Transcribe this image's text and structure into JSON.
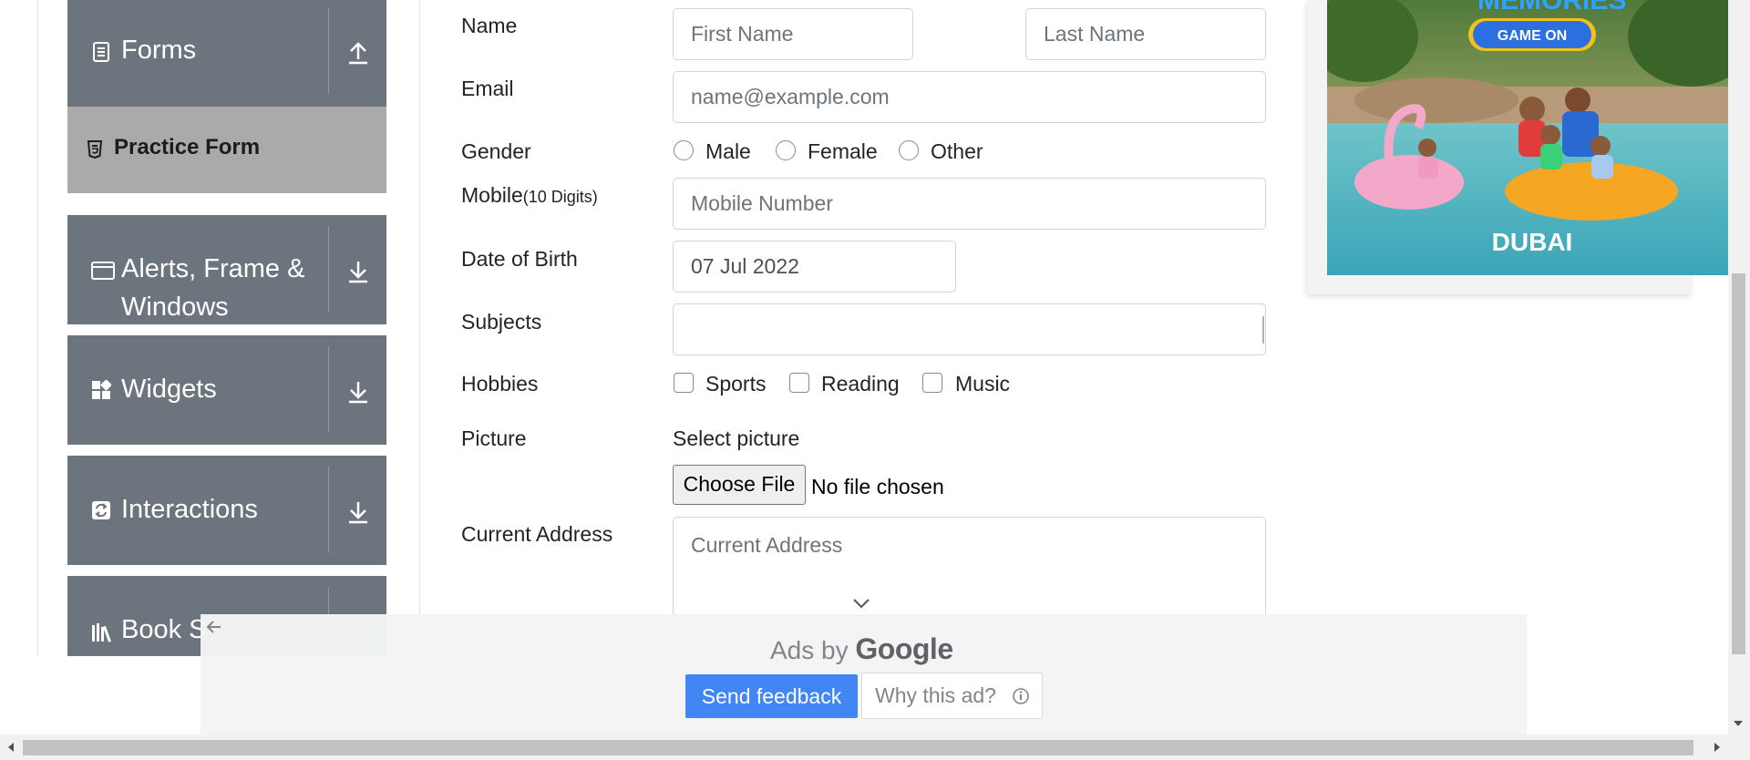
{
  "sidebar": {
    "forms": {
      "label": "Forms",
      "icon": "document-icon",
      "arrow": "arrow-up-icon"
    },
    "practice_form": {
      "label": "Practice Form",
      "icon": "html-file-icon"
    },
    "alerts": {
      "label_line1": "Alerts, Frame &",
      "label_line2": "Windows",
      "icon": "browser-window-icon",
      "arrow": "arrow-down-icon"
    },
    "widgets": {
      "label": "Widgets",
      "icon": "widgets-icon",
      "arrow": "arrow-down-icon"
    },
    "interactions": {
      "label": "Interactions",
      "icon": "interactions-icon",
      "arrow": "arrow-down-icon"
    },
    "book_store": {
      "label": "Book S",
      "icon": "books-icon"
    }
  },
  "form": {
    "name_label": "Name",
    "first_name_placeholder": "First Name",
    "last_name_placeholder": "Last Name",
    "email_label": "Email",
    "email_placeholder": "name@example.com",
    "gender_label": "Gender",
    "gender_options": [
      "Male",
      "Female",
      "Other"
    ],
    "mobile_label": "Mobile",
    "mobile_hint": "(10 Digits)",
    "mobile_placeholder": "Mobile Number",
    "dob_label": "Date of Birth",
    "dob_value": "07 Jul 2022",
    "subjects_label": "Subjects",
    "subjects_value": "",
    "hobbies_label": "Hobbies",
    "hobbies_options": [
      "Sports",
      "Reading",
      "Music"
    ],
    "picture_label": "Picture",
    "select_picture": "Select picture",
    "choose_file": "Choose File",
    "no_file": "No file chosen",
    "address_label": "Current Address",
    "address_placeholder": "Current Address"
  },
  "ad_banner": {
    "top_text": "MEMORIES",
    "button": "GAME ON",
    "brand": "DUBAI"
  },
  "google_ad": {
    "ads_by": "Ads by",
    "google": "Google",
    "send_feedback": "Send feedback",
    "why_this_ad": "Why this ad?"
  },
  "colors": {
    "sidebar_bg": "#6c757d",
    "active_item_bg": "#aaaaaa",
    "feedback_blue": "#4285f4"
  }
}
